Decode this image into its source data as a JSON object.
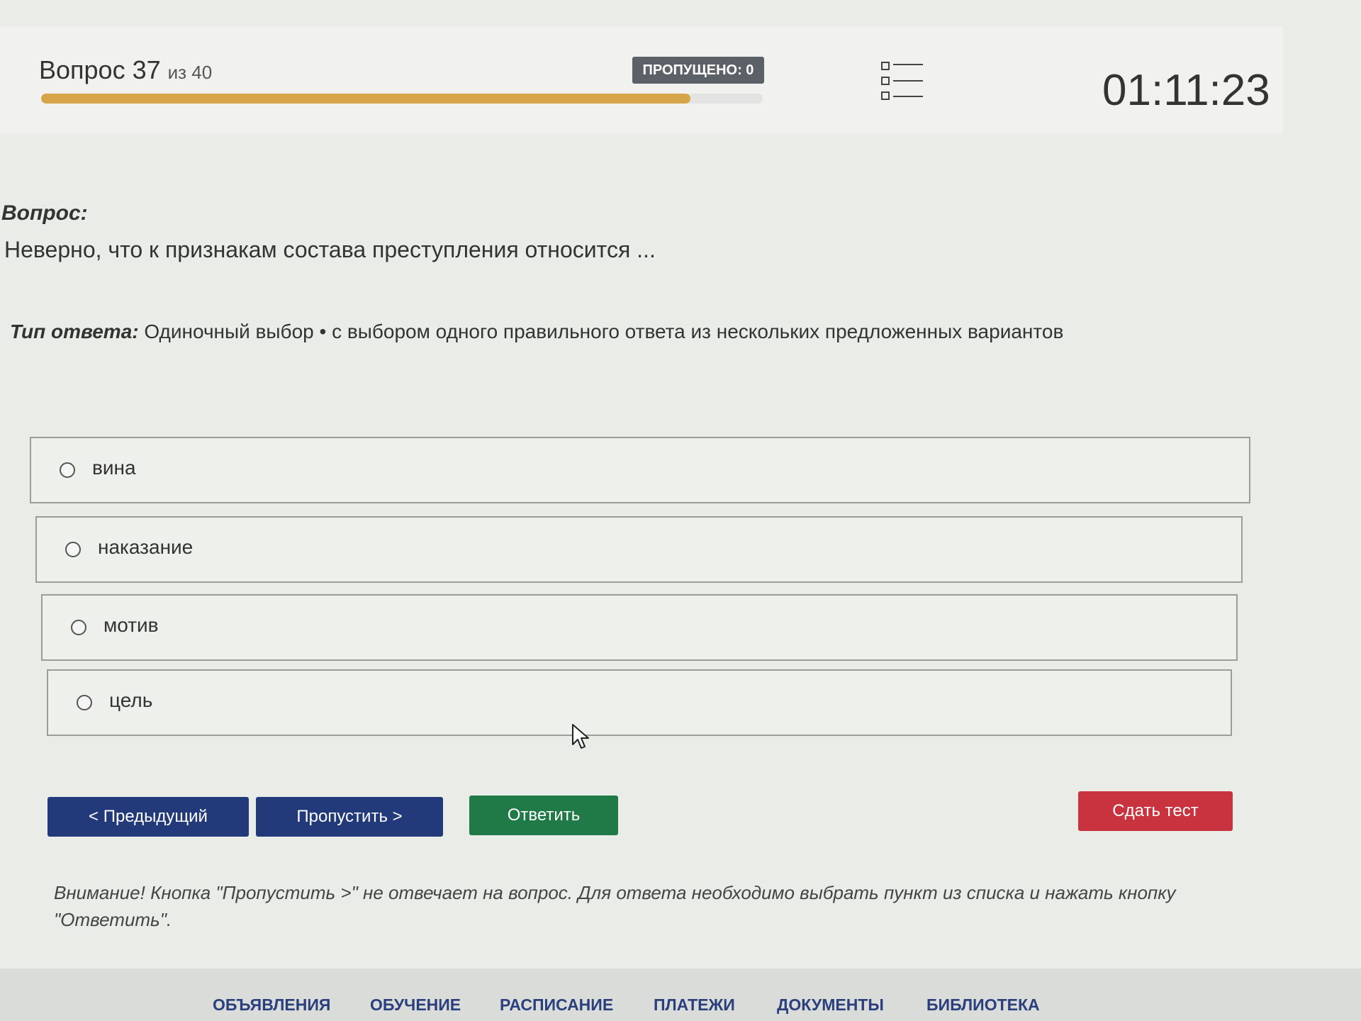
{
  "header": {
    "question_prefix": "Вопрос 37",
    "question_of": "из 40",
    "skipped_badge": "ПРОПУЩЕНО: 0",
    "progress_percent": 90,
    "timer": "01:11:23"
  },
  "question": {
    "label": "Вопрос:",
    "text": "Неверно, что к признакам состава преступления относится ...",
    "answer_type_label": "Тип ответа:",
    "answer_type_value": "Одиночный выбор • с выбором одного правильного ответа из нескольких предложенных вариантов"
  },
  "options": [
    {
      "label": "вина"
    },
    {
      "label": "наказание"
    },
    {
      "label": "мотив"
    },
    {
      "label": "цель"
    }
  ],
  "buttons": {
    "prev": "< Предыдущий",
    "skip": "Пропустить >",
    "answer": "Ответить",
    "submit": "Сдать тест"
  },
  "notice": "Внимание! Кнопка \"Пропустить >\" не отвечает на вопрос. Для ответа необходимо выбрать пункт из списка и нажать кнопку \"Ответить\".",
  "footer": {
    "items": [
      "ОБЪЯВЛЕНИЯ",
      "ОБУЧЕНИЕ",
      "РАСПИСАНИЕ",
      "ПЛАТЕЖИ",
      "ДОКУМЕНТЫ",
      "БИБЛИОТЕКА"
    ]
  },
  "colors": {
    "progress": "#d6a54a",
    "nav_button": "#233a7a",
    "answer_button": "#1f7a48",
    "submit_button": "#c9333f",
    "footer_link": "#2a3f7c"
  }
}
